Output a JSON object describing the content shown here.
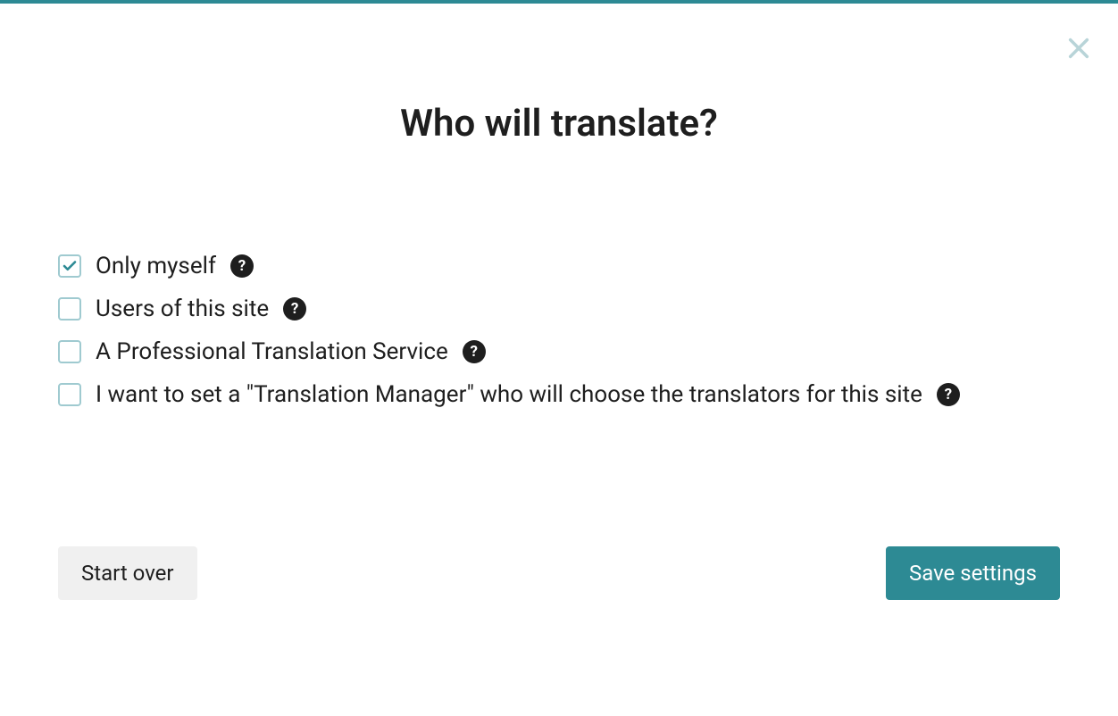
{
  "dialog": {
    "title": "Who will translate?",
    "options": [
      {
        "label": "Only myself",
        "checked": true,
        "help": true
      },
      {
        "label": "Users of this site",
        "checked": false,
        "help": true
      },
      {
        "label": "A Professional Translation Service",
        "checked": false,
        "help": true
      },
      {
        "label": "I want to set a \"Translation Manager\" who will choose the translators for this site",
        "checked": false,
        "help": true
      }
    ],
    "buttons": {
      "start_over": "Start over",
      "save": "Save settings"
    },
    "help_glyph": "?"
  },
  "colors": {
    "accent": "#2d8a94"
  }
}
